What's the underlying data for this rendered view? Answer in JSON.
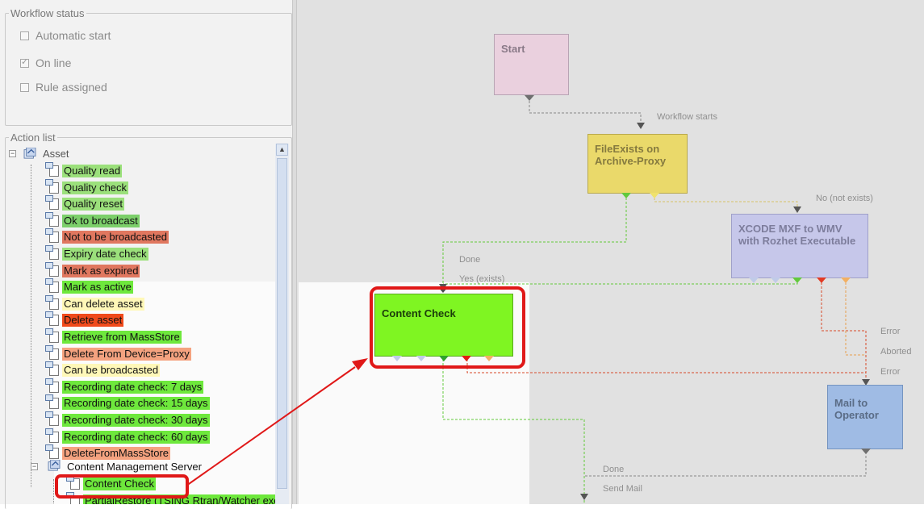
{
  "colors": {
    "green_item": "#6ee83c",
    "green_light_item": "#9be07b",
    "red_item": "#e0775f",
    "bright_red_item": "#f04a1b",
    "salmon_item": "#f4a27f",
    "yellow_item": "#fff8b8",
    "start_node": "#ead0de",
    "fileexists_node": "#ead96a",
    "xcode_node": "#c6c7ea",
    "content_check_node": "#7ff522",
    "mail_node": "#9fbbe4",
    "highlight": "#e01818"
  },
  "workflow_status": {
    "legend": "Workflow status",
    "automatic_start": "Automatic start",
    "on_line": "On line",
    "rule_assigned": "Rule assigned"
  },
  "action_list": {
    "legend": "Action list",
    "root": "Asset",
    "items": [
      {
        "label": "Quality read",
        "color": "#9be07b"
      },
      {
        "label": "Quality check",
        "color": "#9be07b"
      },
      {
        "label": "Quality reset",
        "color": "#9be07b"
      },
      {
        "label": "Ok to broadcast",
        "color": "#7ccf6a"
      },
      {
        "label": "Not to be broadcasted",
        "color": "#e0775f"
      },
      {
        "label": "Expiry date check",
        "color": "#9be07b"
      },
      {
        "label": "Mark as expired",
        "color": "#e0775f"
      },
      {
        "label": "Mark as active",
        "color": "#6ee83c"
      },
      {
        "label": "Can delete asset",
        "color": "#fff8b8"
      },
      {
        "label": "Delete asset",
        "color": "#f04a1b"
      },
      {
        "label": "Retrieve from MassStore",
        "color": "#6ee83c"
      },
      {
        "label": "Delete From Device=Proxy",
        "color": "#f4a27f"
      },
      {
        "label": "Can be broadcasted",
        "color": "#fff8b8"
      },
      {
        "label": "Recording date check: 7 days",
        "color": "#6ee83c"
      },
      {
        "label": "Recording date check: 15 days",
        "color": "#6ee83c"
      },
      {
        "label": "Recording date check: 30 days",
        "color": "#6ee83c"
      },
      {
        "label": "Recording date check: 60 days",
        "color": "#6ee83c"
      },
      {
        "label": "DeleteFromMassStore",
        "color": "#f4a27f"
      }
    ],
    "sub_folder": "Content Management Server",
    "sub_items": [
      {
        "label": "Content Check",
        "color": "#6ee83c"
      },
      {
        "label": "PartialRestore (TSING Rtran/Watcher exe)",
        "color": "#6ee83c"
      }
    ]
  },
  "workflow": {
    "nodes": {
      "start": "Start",
      "fileexists": "FileExists on Archive-Proxy",
      "xcode": "XCODE MXF to WMV with Rozhet Executable",
      "content_check": "Content Check",
      "mail": "Mail to Operator"
    },
    "edge_labels": {
      "workflow_starts": "Workflow starts",
      "no_not_exists": "No (not exists)",
      "done_1": "Done",
      "yes_exists": "Yes (exists)",
      "error_1": "Error",
      "aborted": "Aborted",
      "error_2": "Error",
      "done_2": "Done",
      "send_mail": "Send Mail"
    }
  }
}
